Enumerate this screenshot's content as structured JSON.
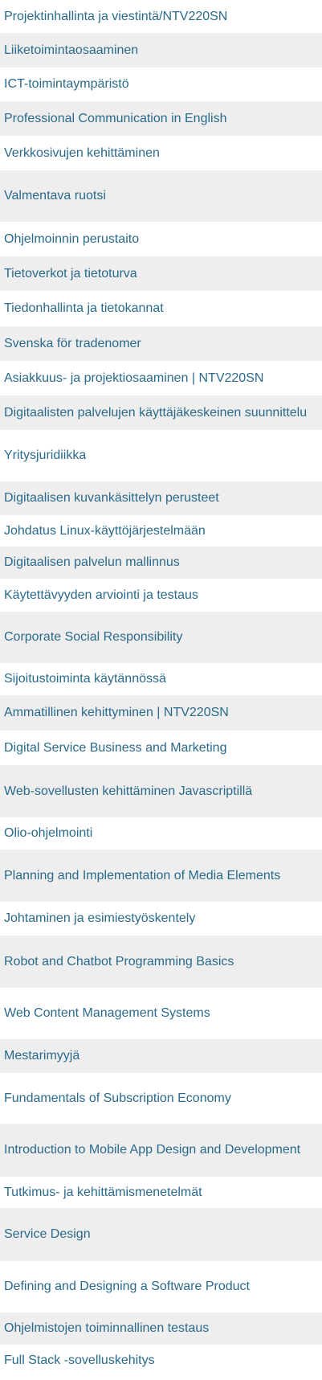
{
  "courses": [
    {
      "name": "Projektinhallinta ja viestintä/NTV220SN"
    },
    {
      "name": "Liiketoimintaosaaminen"
    },
    {
      "name": "ICT-toimintaympäristö"
    },
    {
      "name": "Professional Communication in English"
    },
    {
      "name": "Verkkosivujen kehittäminen"
    },
    {
      "name": "Valmentava ruotsi"
    },
    {
      "name": "Ohjelmoinnin perustaito"
    },
    {
      "name": "Tietoverkot ja tietoturva"
    },
    {
      "name": "Tiedonhallinta ja tietokannat"
    },
    {
      "name": "Svenska för tradenomer"
    },
    {
      "name": "Asiakkuus- ja projektiosaaminen | NTV220SN"
    },
    {
      "name": "Digitaalisten palvelujen käyttäjäkeskeinen suunnittelu"
    },
    {
      "name": "Yritysjuridiikka"
    },
    {
      "name": "Digitaalisen kuvankäsittelyn perusteet"
    },
    {
      "name": "Johdatus Linux-käyttöjärjestelmään"
    },
    {
      "name": "Digitaalisen palvelun mallinnus"
    },
    {
      "name": "Käytettävyyden arviointi ja testaus"
    },
    {
      "name": "Corporate Social Responsibility"
    },
    {
      "name": "Sijoitustoiminta käytännössä"
    },
    {
      "name": "Ammatillinen kehittyminen | NTV220SN"
    },
    {
      "name": "Digital Service Business and Marketing"
    },
    {
      "name": "Web-sovellusten kehittäminen Javascriptillä"
    },
    {
      "name": "Olio-ohjelmointi"
    },
    {
      "name": "Planning and Implementation of Media Elements"
    },
    {
      "name": "Johtaminen ja esimiestyöskentely"
    },
    {
      "name": "Robot and Chatbot Programming Basics"
    },
    {
      "name": "Web Content Management Systems"
    },
    {
      "name": "Mestarimyyjä"
    },
    {
      "name": "Fundamentals of Subscription Economy"
    },
    {
      "name": "Introduction to Mobile App Design and Development"
    },
    {
      "name": "Tutkimus- ja kehittämismenetelmät"
    },
    {
      "name": "Service Design"
    },
    {
      "name": "Defining and Designing a Software Product"
    },
    {
      "name": "Ohjelmistojen toiminnallinen testaus"
    },
    {
      "name": "Full Stack -sovelluskehitys"
    }
  ]
}
